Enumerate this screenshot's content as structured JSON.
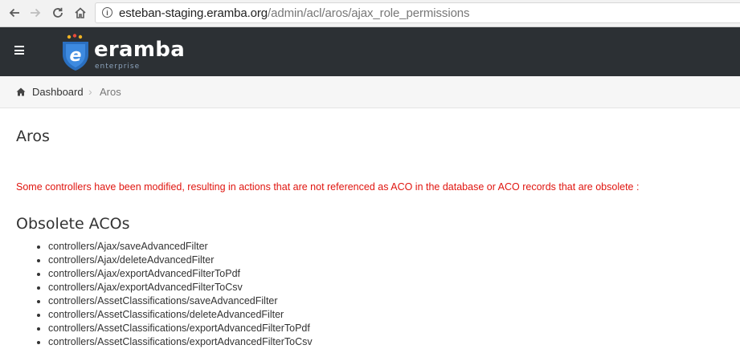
{
  "browser": {
    "url_domain": "esteban-staging.eramba.org",
    "url_path": "/admin/acl/aros/ajax_role_permissions"
  },
  "app": {
    "logo_text": "eramba",
    "logo_subtext": "enterprise"
  },
  "breadcrumb": {
    "home_label": "Dashboard",
    "separator": "›",
    "current": "Aros"
  },
  "main": {
    "title": "Aros",
    "warning": "Some controllers have been modified, resulting in actions that are not referenced as ACO in the database or ACO records that are obsolete :",
    "section_title": "Obsolete ACOs",
    "obsolete_acos": [
      "controllers/Ajax/saveAdvancedFilter",
      "controllers/Ajax/deleteAdvancedFilter",
      "controllers/Ajax/exportAdvancedFilterToPdf",
      "controllers/Ajax/exportAdvancedFilterToCsv",
      "controllers/AssetClassifications/saveAdvancedFilter",
      "controllers/AssetClassifications/deleteAdvancedFilter",
      "controllers/AssetClassifications/exportAdvancedFilterToPdf",
      "controllers/AssetClassifications/exportAdvancedFilterToCsv"
    ]
  },
  "colors": {
    "header_bg": "#2c3034",
    "warning_text": "#e0150f",
    "logo_blue": "#2a6fc0"
  }
}
